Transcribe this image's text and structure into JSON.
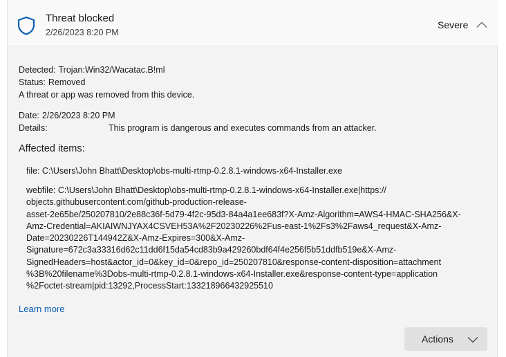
{
  "header": {
    "title": "Threat blocked",
    "timestamp": "2/26/2023 8:20 PM",
    "severity": "Severe",
    "shield_color": "#0a5fb4"
  },
  "detected": {
    "label": "Detected:",
    "value": "Trojan:Win32/Wacatac.B!ml"
  },
  "status": {
    "label": "Status:",
    "value": "Removed"
  },
  "description": "A threat or app was removed from this device.",
  "date": {
    "label": "Date:",
    "value": "2/26/2023 8:20 PM"
  },
  "details": {
    "label": "Details:",
    "value": "This program is dangerous and executes commands from an attacker."
  },
  "affected_heading": "Affected items:",
  "file_item": "file: C:\\Users\\John Bhatt\\Desktop\\obs-multi-rtmp-0.2.8.1-windows-x64-Installer.exe",
  "webfile_lines": [
    "webfile: C:\\Users\\John Bhatt\\Desktop\\obs-multi-rtmp-0.2.8.1-windows-x64-Installer.exe|https://",
    "objects.githubusercontent.com/github-production-release-",
    "asset-2e65be/250207810/2e88c36f-5d79-4f2c-95d3-84a4a1ee683f?X-Amz-Algorithm=AWS4-HMAC-SHA256&X-",
    "Amz-Credential=AKIAIWNJYAX4CSVEH53A%2F20230226%2Fus-east-1%2Fs3%2Faws4_request&X-Amz-",
    "Date=20230226T144942Z&X-Amz-Expires=300&X-Amz-",
    "Signature=672c3a33316d62c11dd6f15da54cd83b9a429260bdf64f4e256f5b51ddfb519e&X-Amz-",
    "SignedHeaders=host&actor_id=0&key_id=0&repo_id=250207810&response-content-disposition=attachment",
    "%3B%20filename%3Dobs-multi-rtmp-0.2.8.1-windows-x64-Installer.exe&response-content-type=application",
    "%2Foctet-stream|pid:13292,ProcessStart:133218966432925510"
  ],
  "learn_more": "Learn more",
  "actions_label": "Actions",
  "icons": {
    "shield": "shield-icon",
    "collapse": "chevron-up-icon",
    "dropdown": "chevron-down-icon"
  }
}
